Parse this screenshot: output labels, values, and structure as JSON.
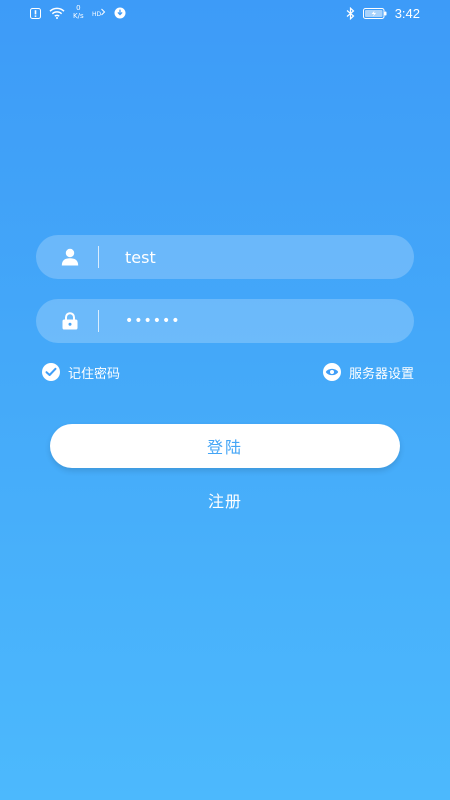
{
  "status_bar": {
    "net_speed_value": "0",
    "net_speed_unit": "K/s",
    "hd_label": "HD",
    "time": "3:42"
  },
  "login_form": {
    "username_value": "test",
    "password_value": "••••••",
    "remember_password_label": "记住密码",
    "server_settings_label": "服务器设置",
    "login_button_label": "登陆",
    "register_label": "注册"
  },
  "colors": {
    "background_top": "#3d9bf8",
    "background_bottom": "#4cb9fd",
    "login_button_text": "#44a5f6"
  },
  "icons": {
    "username": "user-icon",
    "password": "lock-icon",
    "remember": "check-icon",
    "server": "eye-icon"
  }
}
